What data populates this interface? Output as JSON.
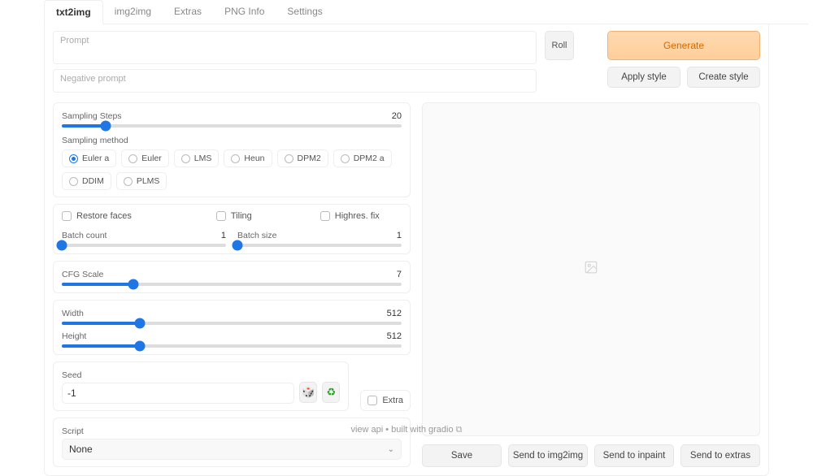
{
  "tabs": [
    {
      "label": "txt2img",
      "active": true
    },
    {
      "label": "img2img",
      "active": false
    },
    {
      "label": "Extras",
      "active": false
    },
    {
      "label": "PNG Info",
      "active": false
    },
    {
      "label": "Settings",
      "active": false
    }
  ],
  "prompt": {
    "placeholder": "Prompt"
  },
  "neg_prompt": {
    "placeholder": "Negative prompt"
  },
  "roll_label": "Roll",
  "generate_label": "Generate",
  "apply_style_label": "Apply style",
  "create_style_label": "Create style",
  "sampling_steps": {
    "label": "Sampling Steps",
    "value": 20,
    "min": 1,
    "max": 150
  },
  "sampling_method": {
    "label": "Sampling method",
    "options": [
      "Euler a",
      "Euler",
      "LMS",
      "Heun",
      "DPM2",
      "DPM2 a",
      "DDIM",
      "PLMS"
    ],
    "selected": "Euler a"
  },
  "checks": {
    "restore_faces": "Restore faces",
    "tiling": "Tiling",
    "highres_fix": "Highres. fix"
  },
  "batch_count": {
    "label": "Batch count",
    "value": 1,
    "min": 1,
    "max": 16
  },
  "batch_size": {
    "label": "Batch size",
    "value": 1,
    "min": 1,
    "max": 8
  },
  "cfg_scale": {
    "label": "CFG Scale",
    "value": 7,
    "min": 1,
    "max": 30
  },
  "width": {
    "label": "Width",
    "value": 512,
    "min": 64,
    "max": 2048
  },
  "height": {
    "label": "Height",
    "value": 512,
    "min": 64,
    "max": 2048
  },
  "seed": {
    "label": "Seed",
    "value": "-1"
  },
  "extra_label": "Extra",
  "dice_icon": "🎲",
  "recycle_icon": "♻",
  "script": {
    "label": "Script",
    "selected": "None"
  },
  "send": {
    "save": "Save",
    "img2img": "Send to img2img",
    "inpaint": "Send to inpaint",
    "extras": "Send to extras"
  },
  "footer": {
    "view_api": "view api",
    "sep": " • ",
    "built": "built with gradio",
    "api_icon": "⧉"
  },
  "preview_icon": "🖼"
}
